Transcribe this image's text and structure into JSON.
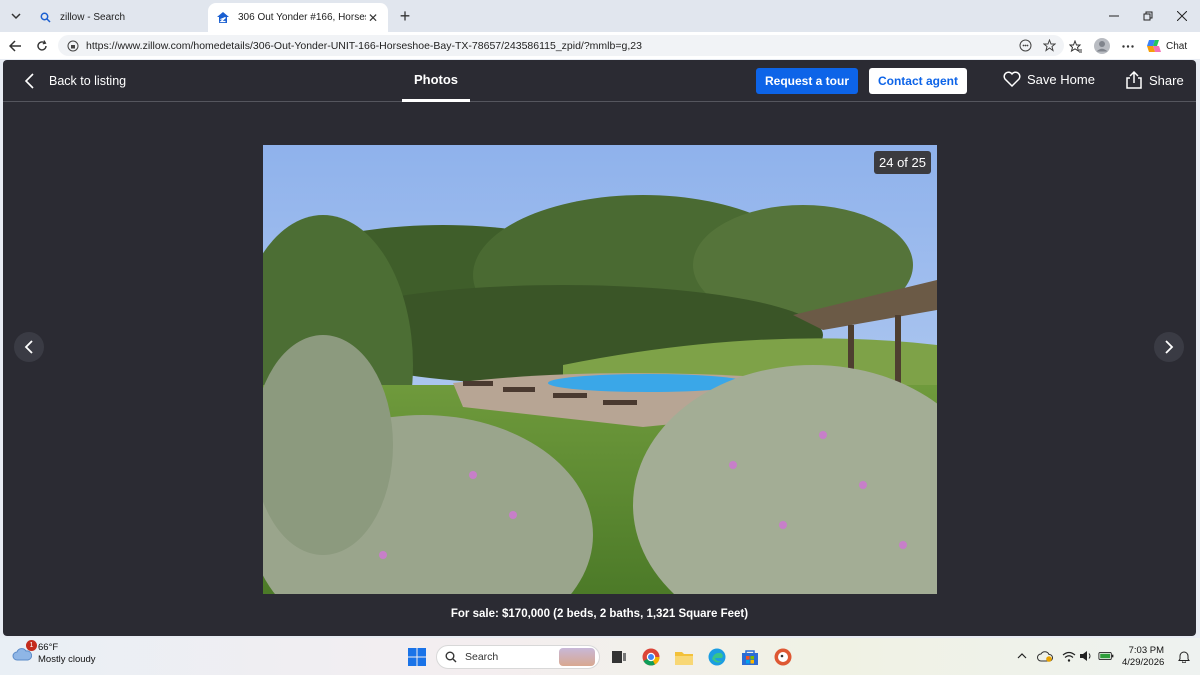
{
  "browser": {
    "tabs": [
      {
        "title": "zillow - Search",
        "active": false
      },
      {
        "title": "306 Out Yonder #166, Horseshoe B",
        "active": true
      }
    ],
    "url": "https://www.zillow.com/homedetails/306-Out-Yonder-UNIT-166-Horseshoe-Bay-TX-78657/243586115_zpid/?mmlb=g,23",
    "chat_label": "Chat"
  },
  "viewer": {
    "back_label": "Back to listing",
    "photos_tab": "Photos",
    "request_tour": "Request a tour",
    "contact_agent": "Contact agent",
    "save_home": "Save Home",
    "share": "Share",
    "counter": "24 of 25",
    "caption": "For sale: $170,000 (2 beds, 2 baths, 1,321 Square Feet)"
  },
  "taskbar": {
    "weather_temp": "66°F",
    "weather_desc": "Mostly cloudy",
    "weather_badge": "1",
    "search_placeholder": "Search",
    "time": "7:03 PM",
    "date": "4/29/2026"
  },
  "colors": {
    "accent": "#0d64e8",
    "viewer_bg": "#2b2b33"
  }
}
